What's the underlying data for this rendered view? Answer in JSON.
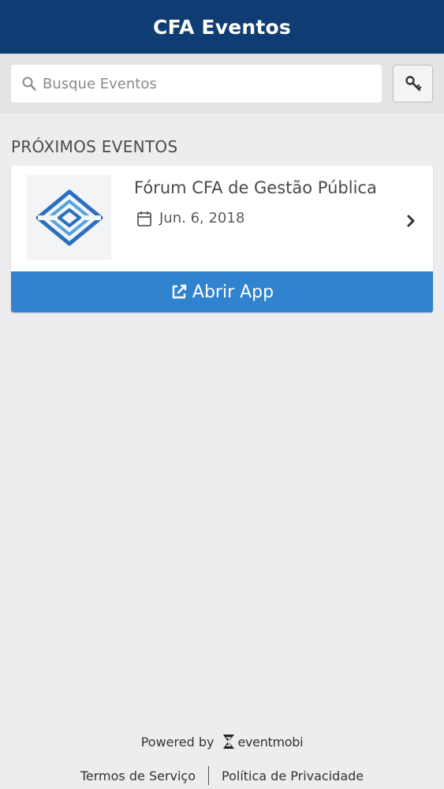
{
  "header": {
    "title": "CFA Eventos"
  },
  "search": {
    "placeholder": "Busque Eventos",
    "value": ""
  },
  "section": {
    "title": "PRÓXIMOS EVENTOS"
  },
  "events": [
    {
      "name": "Fórum CFA de Gestão Pública",
      "date": "Jun. 6, 2018",
      "open_label": "Abrir App"
    }
  ],
  "footer": {
    "powered_by": "Powered by",
    "brand": "eventmobi",
    "terms": "Termos de Serviço",
    "privacy": "Política de Privacidade"
  },
  "colors": {
    "header_bg": "#0f3d73",
    "accent": "#3183cf",
    "background": "#ededef"
  }
}
